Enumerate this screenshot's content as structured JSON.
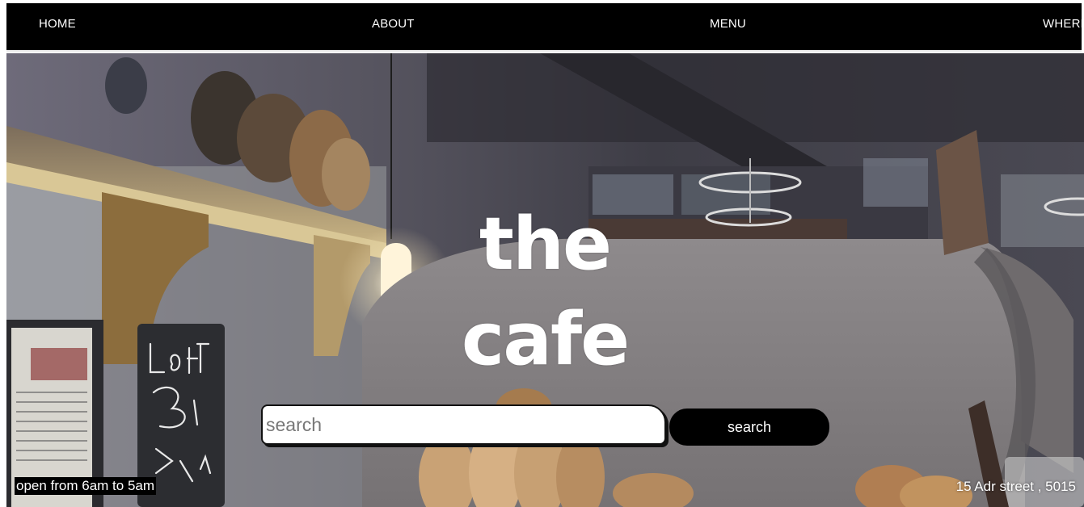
{
  "nav": {
    "items": [
      {
        "label": "HOME"
      },
      {
        "label": "ABOUT"
      },
      {
        "label": "MENU"
      },
      {
        "label": "WHERE"
      }
    ]
  },
  "hero": {
    "title_line1": "the",
    "title_line2": "cafe",
    "chalkboard_text": "LoaF Too Big Any 1/2 LoaF £2"
  },
  "search": {
    "placeholder": "search",
    "value": "",
    "button_label": "search"
  },
  "footer": {
    "hours": "open from 6am to 5am",
    "address": "15 Adr street , 5015"
  },
  "colors": {
    "nav_bg": "#000000",
    "text_light": "#ffffff",
    "button_bg": "#000000"
  }
}
